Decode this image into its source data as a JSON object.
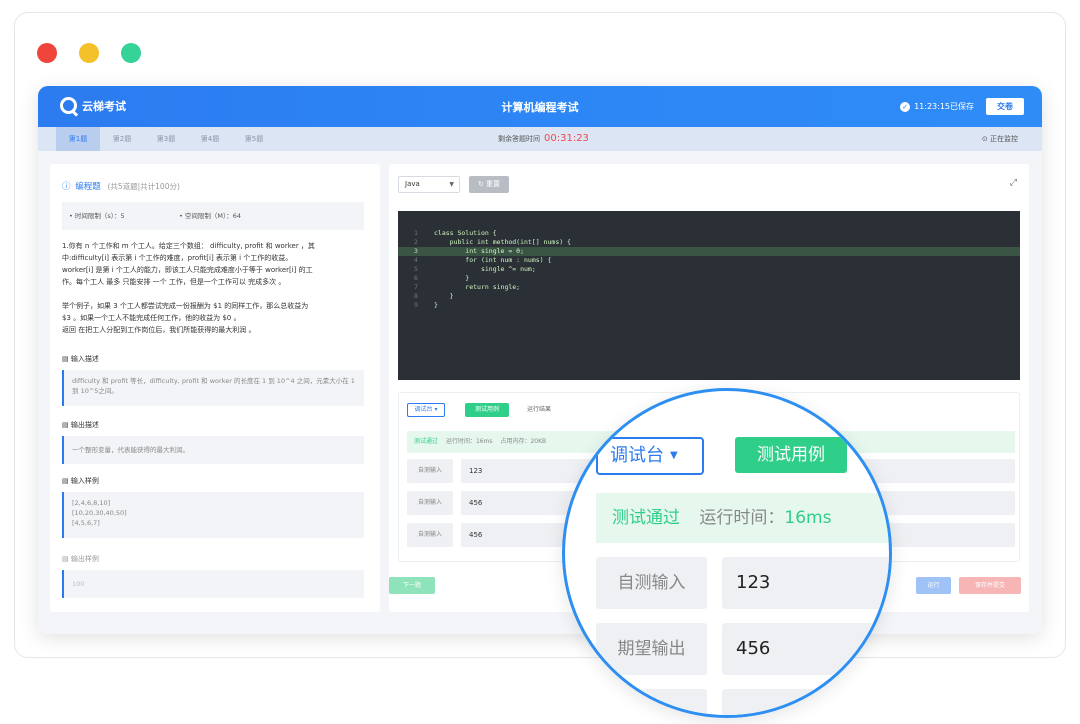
{
  "header": {
    "logo_text": "云梯考试",
    "title": "计算机编程考试",
    "saved_text": "11:23:15已保存",
    "submit_label": "交卷"
  },
  "tabs": [
    "第1题",
    "第2题",
    "第3题",
    "第4题",
    "第5题"
  ],
  "timer": {
    "label": "剩余答题时间",
    "value": "00:31:23"
  },
  "monitor": "正在监控",
  "question": {
    "type": "编程题",
    "meta": "(共5道题|共计100分)",
    "time_limit": "• 时间限制（s）：5",
    "space_limit": "• 空间限制（M）：64",
    "desc_lines": [
      "1.你有 n 个工作和 m 个工人。给定三个数组： difficulty, profit 和 worker ，其",
      "中:difficulty[i] 表示第 i 个工作的难度，profit[i] 表示第 i 个工作的收益。",
      "worker[i] 是第 i 个工人的能力，即该工人只能完成难度小于等于 worker[i] 的工",
      "作。每个工人 最多 只能安排 一个 工作，但是一个工作可以 完成多次 。",
      "",
      "举个例子，如果 3 个工人都尝试完成一份报酬为 $1 的同样工作，那么总收益为",
      "$3 。如果一个工人不能完成任何工作，他的收益为 $0 。",
      "返回 在把工人分配到工作岗位后，我们所能获得的最大利润 。"
    ],
    "input_desc_title": "输入描述",
    "input_desc": "difficulty 和 profit 等长，difficulty, profit 和 worker 的长度在 1 到 10^4 之间，元素大小在 1 到 10^5之间。",
    "output_desc_title": "输出描述",
    "output_desc": "一个整形变量，代表能获得的最大利润。",
    "input_sample_title": "输入样例",
    "input_sample": [
      "[2,4,6,8,10]",
      "[10,20,30,40,50]",
      "[4,5,6,7]"
    ],
    "output_sample_title": "输出样例",
    "output_sample": "100"
  },
  "editor": {
    "language": "Java",
    "reset_label": "重置",
    "lines": [
      "class Solution {",
      "    public int method(int[] nums) {",
      "        int single = 0;",
      "        for (int num : nums) {",
      "            single ^= num;",
      "        }",
      "        return single;",
      "    }",
      "}"
    ]
  },
  "console": {
    "debug_label": "调试台",
    "testcase_label": "测试用例",
    "result_label": "运行结果",
    "pass_text": "测试通过",
    "runtime": "运行时间：16ms",
    "memory": "占用内存：20KB",
    "rows": [
      {
        "key": "自测输入",
        "value": "123"
      },
      {
        "key": "自测输入",
        "value": "456"
      },
      {
        "key": "自测输入",
        "value": "456"
      }
    ]
  },
  "buttons": {
    "next": "下一题",
    "run": "运行",
    "save_submit": "保存并提交"
  },
  "magnifier": {
    "debug_label": "调试台",
    "testcase_label": "测试用例",
    "pass_text": "测试通过",
    "runtime_label": "运行时间：",
    "runtime_value": "16ms",
    "rows": [
      {
        "key": "自测输入",
        "value": "123"
      },
      {
        "key": "期望输出",
        "value": "456"
      }
    ]
  }
}
